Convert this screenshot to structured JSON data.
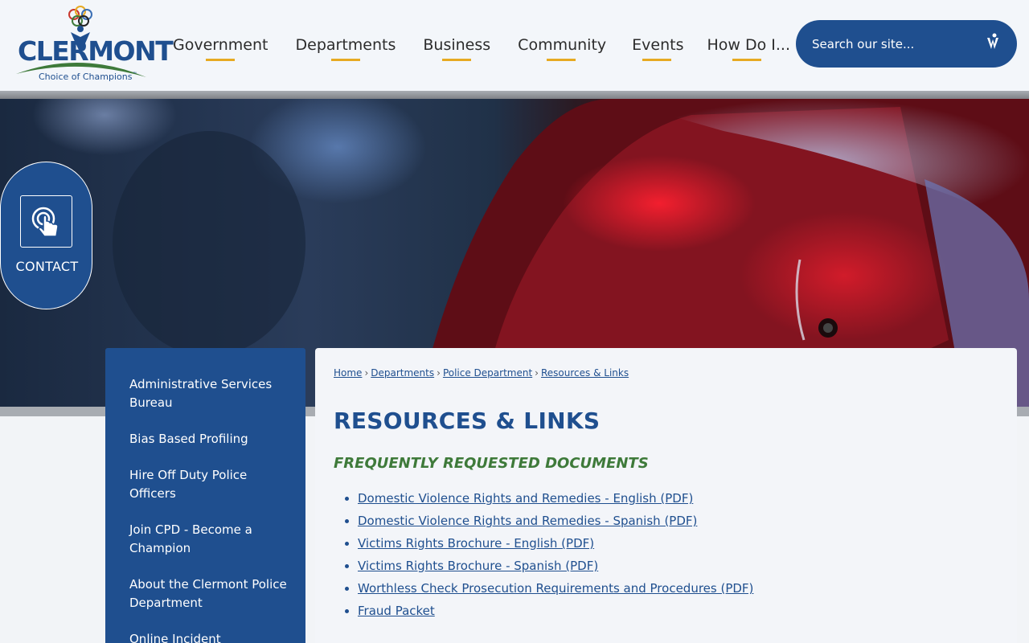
{
  "brand": {
    "name": "CLERMONT",
    "tagline": "Choice of Champions",
    "trademark": "™",
    "colors": {
      "primary": "#1f4f8f",
      "accent": "#e7aa22",
      "green": "#3e7a3a"
    }
  },
  "nav": {
    "items": [
      {
        "label": "Government"
      },
      {
        "label": "Departments"
      },
      {
        "label": "Business"
      },
      {
        "label": "Community"
      },
      {
        "label": "Events"
      },
      {
        "label": "How Do I..."
      }
    ]
  },
  "search": {
    "placeholder": "Search our site...",
    "icon": "search-logo-icon"
  },
  "contact": {
    "label": "CONTACT",
    "icon": "touch-hand-icon"
  },
  "sidebar": {
    "items": [
      {
        "label": "Administrative Services Bureau"
      },
      {
        "label": "Bias Based Profiling"
      },
      {
        "label": "Hire Off Duty Police Officers"
      },
      {
        "label": "Join CPD - Become a Champion"
      },
      {
        "label": "About the Clermont Police Department"
      },
      {
        "label": "Online Incident"
      }
    ]
  },
  "breadcrumb": {
    "items": [
      {
        "label": "Home"
      },
      {
        "label": "Departments"
      },
      {
        "label": "Police Department"
      },
      {
        "label": "Resources & Links"
      }
    ],
    "separator": "›"
  },
  "main": {
    "title": "RESOURCES & LINKS",
    "section_title": "FREQUENTLY REQUESTED DOCUMENTS",
    "documents": [
      {
        "label": "Domestic Violence Rights and Remedies - English (PDF)"
      },
      {
        "label": "Domestic Violence Rights and Remedies - Spanish (PDF)"
      },
      {
        "label": "Victims Rights Brochure - English (PDF)"
      },
      {
        "label": "Victims Rights Brochure - Spanish (PDF)"
      },
      {
        "label": "Worthless Check Prosecution Requirements and Procedures (PDF)"
      },
      {
        "label": "Fraud Packet"
      }
    ]
  }
}
